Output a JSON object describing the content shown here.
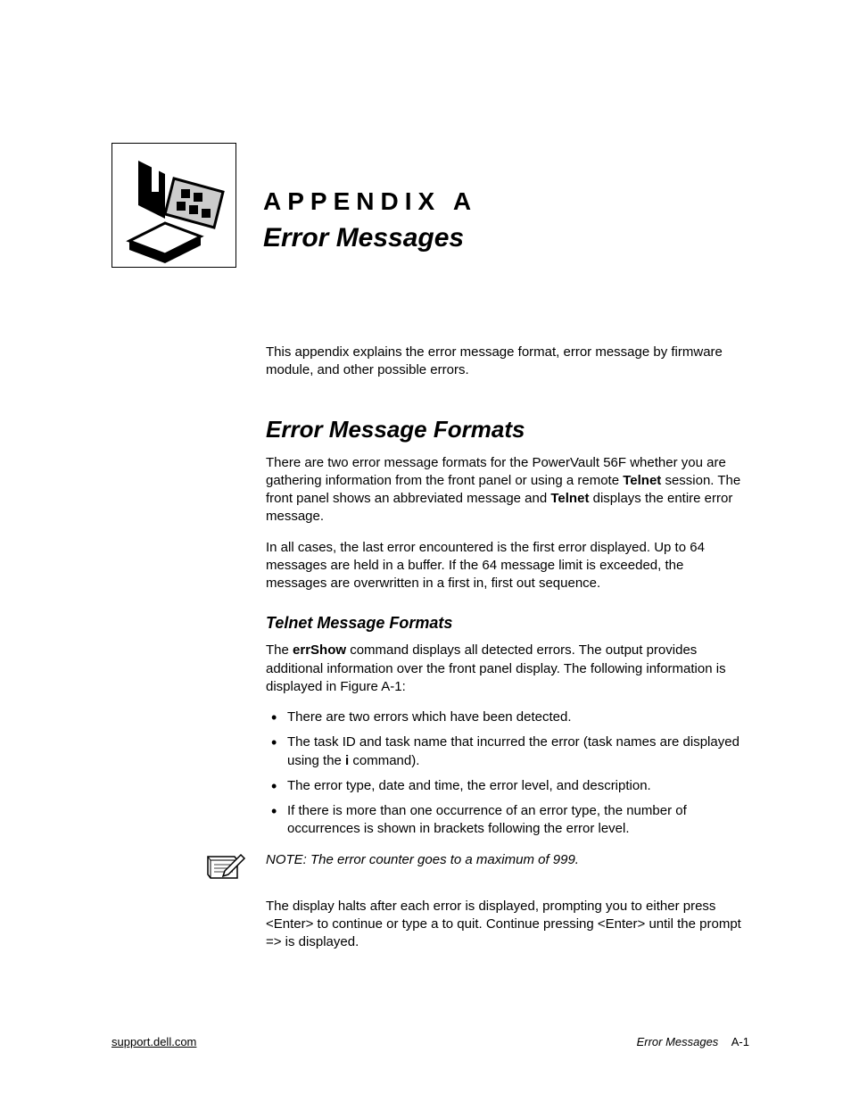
{
  "header": {
    "label": "APPENDIX A",
    "title": "Error Messages"
  },
  "intro": "This appendix explains the error message format, error message by firmware module, and other possible errors.",
  "section1": {
    "heading": "Error Message Formats",
    "p1_a": "There are two error message formats for the PowerVault 56F whether you are gathering information from the front panel or using a remote ",
    "p1_b": "Telnet",
    "p1_c": " session. The front panel shows an abbreviated message and ",
    "p1_d": "Telnet",
    "p1_e": " displays the entire error message.",
    "p2": "In all cases, the last error encountered is the first error displayed. Up to 64 messages are held in a buffer. If the 64 message limit is exceeded, the messages are overwritten in a first in, first out sequence."
  },
  "section2": {
    "heading": "Telnet Message Formats",
    "p1_a": "The ",
    "p1_b": "errShow",
    "p1_c": " command displays all detected errors. The output provides additional information over the front panel display. The following information is displayed in Figure A-1:",
    "bullets": {
      "b1": "There are two errors which have been detected.",
      "b2_a": "The task ID and task name that incurred the error (task names are displayed using the ",
      "b2_b": "i",
      "b2_c": " command).",
      "b3": "The error type, date and time, the error level, and description.",
      "b4": "If there is more than one occurrence of an error type, the number of occurrences is shown in brackets following the error level."
    },
    "note": "NOTE: The error counter goes to a maximum of 999.",
    "p2": "The display halts after each error is displayed, prompting you to either press <Enter> to continue or type a    to quit. Continue pressing <Enter> until the prompt =>  is displayed."
  },
  "footer": {
    "left": "support.dell.com",
    "right_section": "Error Messages",
    "right_page": "A-1"
  }
}
